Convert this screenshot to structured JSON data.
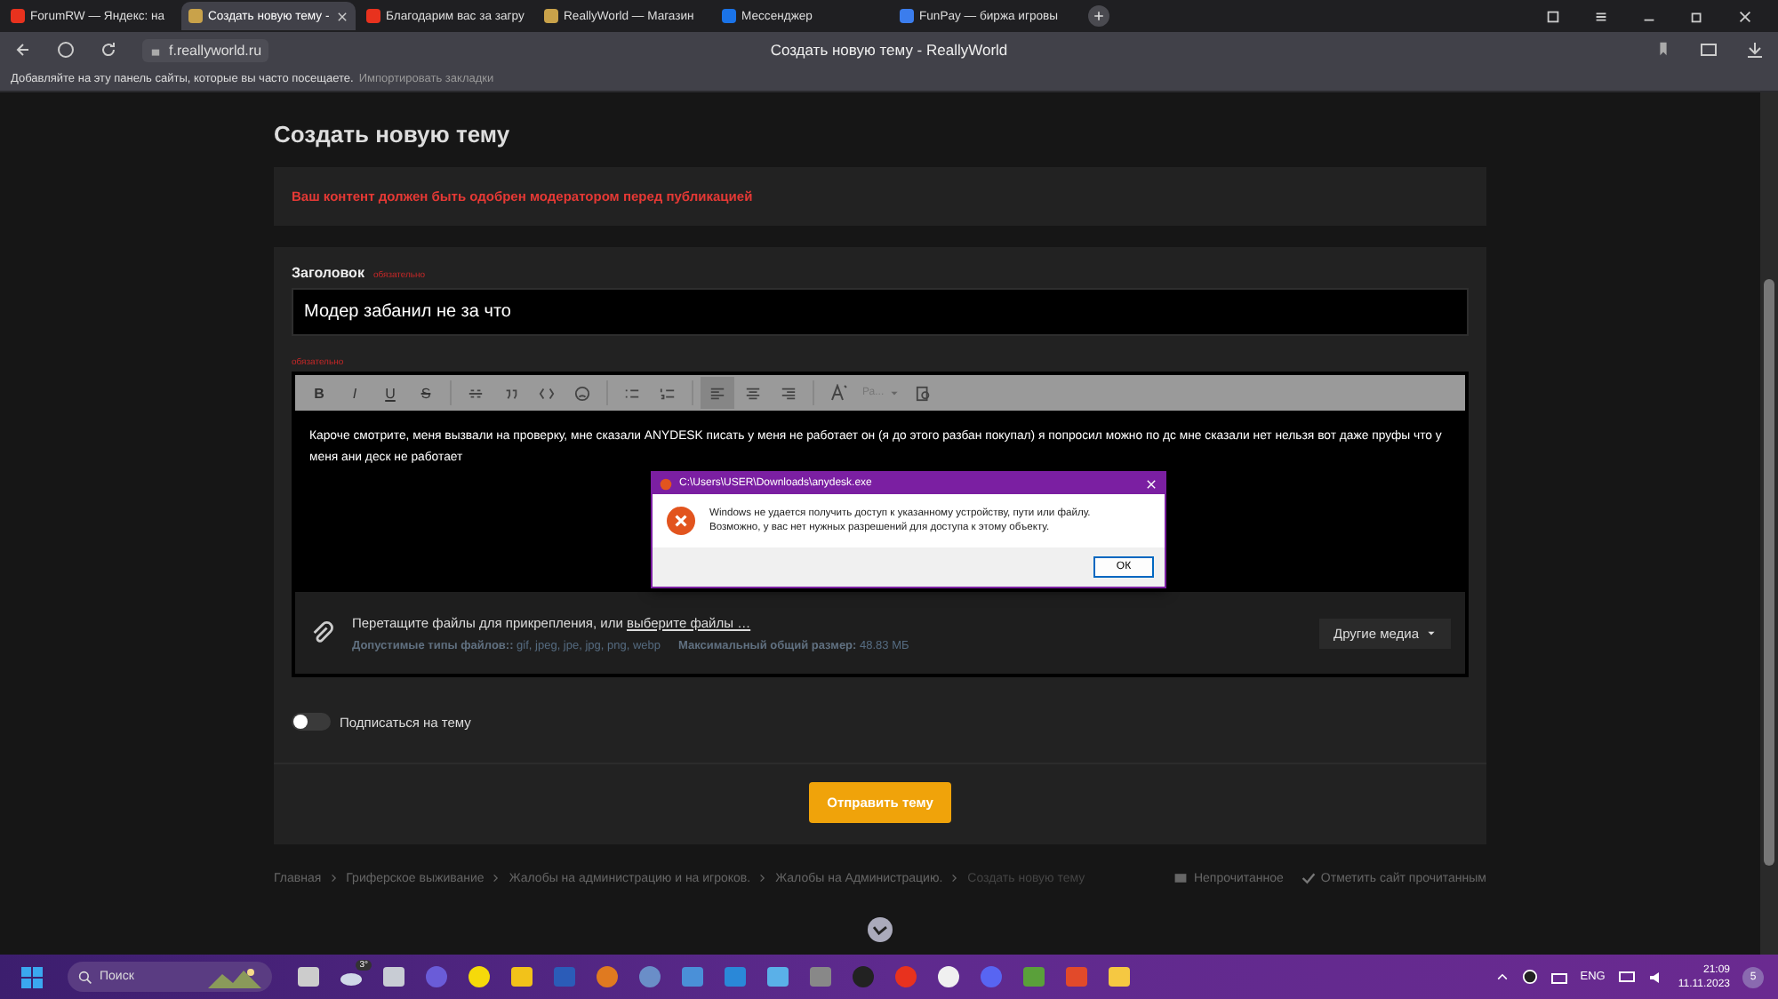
{
  "browser": {
    "tabs": [
      {
        "label": "ForumRW — Яндекс: на",
        "selected": false,
        "color": "#e8321e"
      },
      {
        "label": "Создать новую тему -",
        "selected": true,
        "color": "#c9a24a"
      },
      {
        "label": "Благодарим вас за загру",
        "selected": false,
        "color": "#e8321e"
      },
      {
        "label": "ReallyWorld — Магазин",
        "selected": false,
        "color": "#c9a24a"
      },
      {
        "label": "Мессенджер",
        "selected": false,
        "color": "#1a73e8"
      },
      {
        "label": "FunPay — биржа игровы",
        "selected": false,
        "color": "#3b7ded"
      }
    ],
    "address": "f.reallyworld.ru",
    "page_title": "Создать новую тему - ReallyWorld",
    "bookmarks_hint": "Добавляйте на эту панель сайты, которые вы часто посещаете.",
    "bookmarks_import": "Импортировать закладки"
  },
  "page": {
    "heading": "Создать новую тему",
    "notice": "Ваш контент должен быть одобрен модератором перед публикацией",
    "title_label": "Заголовок",
    "title_required": "обязательно",
    "title_value": "Модер забанил не за что",
    "body_required": "обязательно",
    "format_buttons": [
      "B",
      "I",
      "U",
      "S"
    ],
    "align_buttons": [
      {
        "selected": true
      },
      {
        "selected": false
      },
      {
        "selected": false
      }
    ],
    "paragraph_select": "Ра...",
    "body": "Кароче смотрите, меня вызвали на проверку, мне сказали ANYDESK писать у меня не работает он (я до этого разбан покупал) я попросил можно по дс мне сказали нет нельзя вот даже пруфы что у меня ани деск не работает",
    "attach_text": "Перетащите файлы для прикрепления, или ",
    "attach_link": "выберите файлы …",
    "types_label": "Допустимые типы файлов::",
    "types_value": "gif, jpeg, jpe, jpg, png, webp",
    "size_label": "Максимальный общий размер:",
    "size_value": "48.83 МБ",
    "media_button": "Другие медиа",
    "subscribe": {
      "label": "Подписаться на тему",
      "on": false
    },
    "submit": "Отправить тему",
    "breadcrumbs": [
      "Главная",
      "Гриферское выживание",
      "Жалобы на администрацию и на игроков.",
      "Жалобы на Администрацию.",
      "Создать новую тему"
    ],
    "unread": "Непрочитанное",
    "mark_read": "Отметить сайт прочитанным"
  },
  "dialog": {
    "title": "C:\\Users\\USER\\Downloads\\anydesk.exe",
    "message": "Windows не удается получить доступ к указанному устройству, пути или файлу. Возможно, у вас нет нужных разрешений для доступа к этому объекту.",
    "ok": "ОК"
  },
  "taskbar": {
    "search": "Поиск",
    "weather": "3°",
    "language": "ENG",
    "time": "21:09",
    "date": "11.11.2023",
    "notifications": "5"
  }
}
